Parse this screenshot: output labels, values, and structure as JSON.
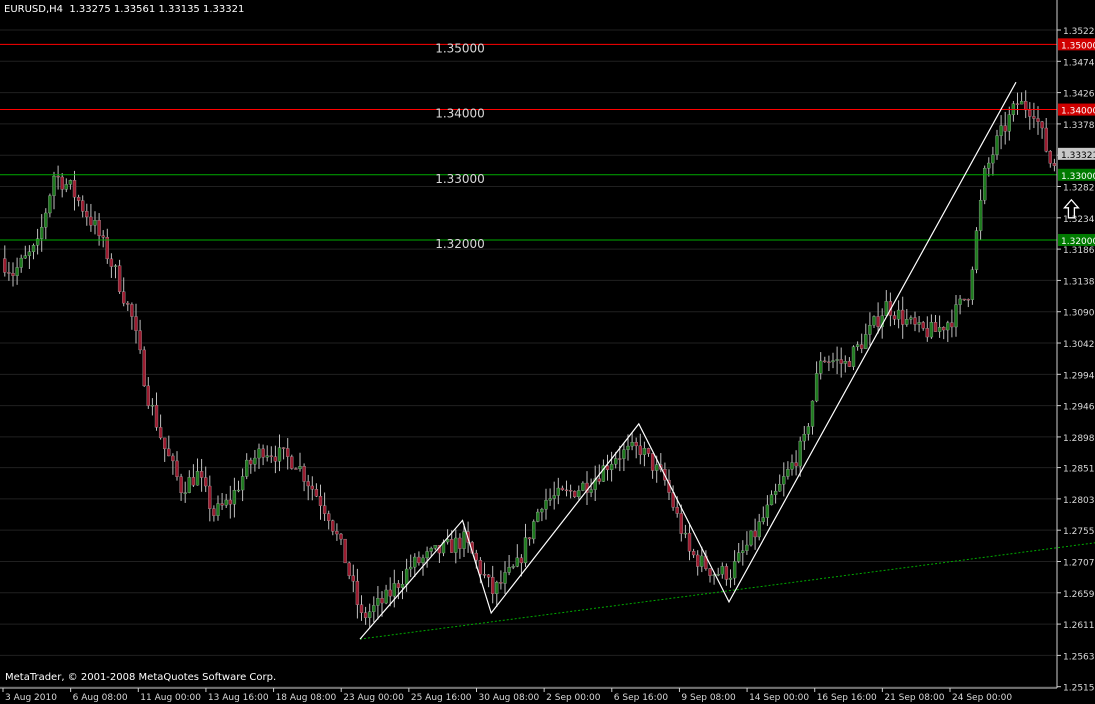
{
  "header": {
    "symbol": "EURUSD,H4",
    "ohlc": "1.33275 1.33561 1.33135 1.33321"
  },
  "copyright": "MetaTrader, © 2001-2008 MetaQuotes Software Corp.",
  "chart_data": {
    "type": "candlestick",
    "symbol": "EURUSD",
    "timeframe": "H4",
    "ylim": [
      1.2513,
      1.3568
    ],
    "y_ticks": [
      "1.35220",
      "1.34740",
      "1.34260",
      "1.33780",
      "1.33300",
      "1.32820",
      "1.32340",
      "1.31860",
      "1.31380",
      "1.30900",
      "1.30420",
      "1.29940",
      "1.29460",
      "1.28980",
      "1.28510",
      "1.28030",
      "1.27550",
      "1.27070",
      "1.26590",
      "1.26110",
      "1.25630",
      "1.25150"
    ],
    "x_ticks": [
      "3 Aug 2010",
      "6 Aug 08:00",
      "11 Aug 00:00",
      "13 Aug 16:00",
      "18 Aug 08:00",
      "23 Aug 00:00",
      "25 Aug 16:00",
      "30 Aug 08:00",
      "2 Sep 00:00",
      "6 Sep 16:00",
      "9 Sep 08:00",
      "14 Sep 00:00",
      "16 Sep 16:00",
      "21 Sep 08:00",
      "24 Sep 00:00"
    ],
    "current_price": "1.33321",
    "horizontal_levels": [
      {
        "value": 1.35,
        "label": "1.35000",
        "axis_label": "1.35000",
        "color": "#ff0000"
      },
      {
        "value": 1.34,
        "label": "1.34000",
        "axis_label": "1.34000",
        "color": "#ff0000"
      },
      {
        "value": 1.33,
        "label": "1.33000",
        "axis_label": "1.33000",
        "color": "#00aa00"
      },
      {
        "value": 1.32,
        "label": "1.32000",
        "axis_label": "1.32000",
        "color": "#00aa00"
      }
    ],
    "zigzag": [
      {
        "bar": 0,
        "price": 1.2588
      },
      {
        "bar": 25,
        "price": 1.277
      },
      {
        "bar": 32,
        "price": 1.2628
      },
      {
        "bar": 68,
        "price": 1.2918
      },
      {
        "bar": 90,
        "price": 1.2645
      },
      {
        "bar": 160,
        "price": 1.3442
      }
    ],
    "trendline": {
      "from": {
        "bar": 0,
        "price": 1.2588
      },
      "to": {
        "bar": 227,
        "price": 1.2775
      },
      "color": "#00aa00",
      "style": "dotted"
    },
    "key_points": [
      {
        "bar": -94,
        "price": 1.323
      },
      {
        "bar": -92,
        "price": 1.32
      },
      {
        "bar": -85,
        "price": 1.315
      },
      {
        "bar": -79,
        "price": 1.319
      },
      {
        "bar": -75,
        "price": 1.33
      },
      {
        "bar": -71,
        "price": 1.328
      },
      {
        "bar": -65,
        "price": 1.322
      },
      {
        "bar": -60,
        "price": 1.315
      },
      {
        "bar": -56,
        "price": 1.308
      },
      {
        "bar": -52,
        "price": 1.296
      },
      {
        "bar": -48,
        "price": 1.288
      },
      {
        "bar": -44,
        "price": 1.282
      },
      {
        "bar": -40,
        "price": 1.284
      },
      {
        "bar": -36,
        "price": 1.278
      },
      {
        "bar": -32,
        "price": 1.28
      },
      {
        "bar": -28,
        "price": 1.285
      },
      {
        "bar": -24,
        "price": 1.288
      },
      {
        "bar": -20,
        "price": 1.287
      },
      {
        "bar": -16,
        "price": 1.286
      },
      {
        "bar": -12,
        "price": 1.282
      },
      {
        "bar": -8,
        "price": 1.278
      },
      {
        "bar": -4,
        "price": 1.271
      },
      {
        "bar": 0,
        "price": 1.262
      },
      {
        "bar": 6,
        "price": 1.265
      },
      {
        "bar": 12,
        "price": 1.27
      },
      {
        "bar": 18,
        "price": 1.272
      },
      {
        "bar": 25,
        "price": 1.274
      },
      {
        "bar": 32,
        "price": 1.266
      },
      {
        "bar": 38,
        "price": 1.27
      },
      {
        "bar": 44,
        "price": 1.28
      },
      {
        "bar": 50,
        "price": 1.281
      },
      {
        "bar": 56,
        "price": 1.283
      },
      {
        "bar": 62,
        "price": 1.287
      },
      {
        "bar": 68,
        "price": 1.288
      },
      {
        "bar": 74,
        "price": 1.283
      },
      {
        "bar": 80,
        "price": 1.272
      },
      {
        "bar": 86,
        "price": 1.269
      },
      {
        "bar": 90,
        "price": 1.269
      },
      {
        "bar": 96,
        "price": 1.275
      },
      {
        "bar": 102,
        "price": 1.282
      },
      {
        "bar": 108,
        "price": 1.289
      },
      {
        "bar": 112,
        "price": 1.302
      },
      {
        "bar": 118,
        "price": 1.301
      },
      {
        "bar": 124,
        "price": 1.306
      },
      {
        "bar": 128,
        "price": 1.31
      },
      {
        "bar": 132,
        "price": 1.308
      },
      {
        "bar": 136,
        "price": 1.306
      },
      {
        "bar": 140,
        "price": 1.306
      },
      {
        "bar": 144,
        "price": 1.308
      },
      {
        "bar": 148,
        "price": 1.312
      },
      {
        "bar": 152,
        "price": 1.33
      },
      {
        "bar": 155,
        "price": 1.335
      },
      {
        "bar": 160,
        "price": 1.341
      },
      {
        "bar": 164,
        "price": 1.34
      },
      {
        "bar": 168,
        "price": 1.332
      },
      {
        "bar": 172,
        "price": 1.331
      },
      {
        "bar": 174,
        "price": 1.3332
      }
    ],
    "marker": {
      "type": "up-arrow",
      "bar": 174,
      "price": 1.328
    },
    "colors": {
      "background": "#000000",
      "grid": "#202020",
      "axis": "#cfcfcf",
      "bull_candle": "#1f7a1f",
      "bear_candle": "#9b1c30",
      "wick": "#bfbfbf",
      "zigzag": "#ffffff",
      "current_price_box": "#c8c8c8"
    }
  }
}
